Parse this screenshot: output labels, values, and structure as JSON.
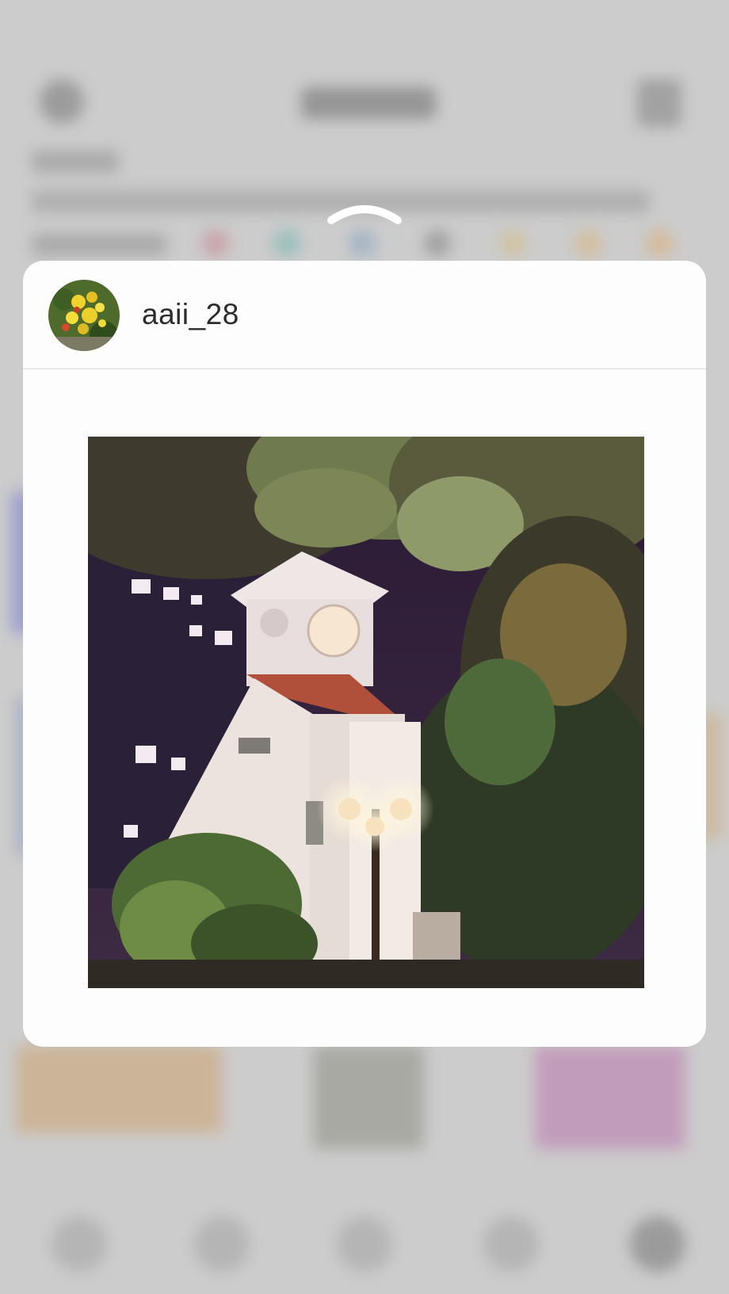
{
  "preview": {
    "username": "aaii_28",
    "avatar_icon": "flower-avatar-icon",
    "photo_icon": "clock-tower-night-photo",
    "swipe_icon": "chevron-up-icon"
  },
  "colors": {
    "card_background": "#fdfdfd",
    "divider": "#d9d9d9",
    "username_text": "#2c2c2c",
    "background_dim": "#c9c9c9"
  }
}
